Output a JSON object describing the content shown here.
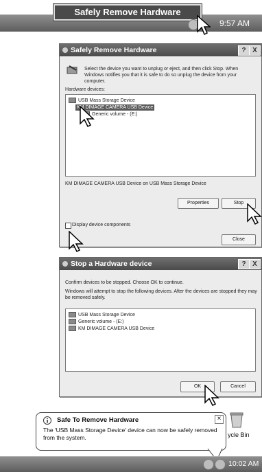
{
  "top_taskbar": {
    "tooltip": "Safely Remove Hardware",
    "time": "9:57 AM"
  },
  "safely_remove_window": {
    "title": "Safely Remove Hardware",
    "instructions": "Select the device you want to unplug or eject, and then click Stop. When Windows notifies you that it is safe to do so unplug the device from your computer.",
    "hardware_label": "Hardware devices:",
    "devices": [
      "USB Mass Storage Device",
      "KM DIMAGE CAMERA USB Device",
      "Generic volume - (E:)"
    ],
    "status": "KM DIMAGE CAMERA USB Device on USB Mass Storage Device",
    "properties_btn": "Properties",
    "stop_btn": "Stop",
    "display_components": "Display device components",
    "close_btn": "Close"
  },
  "stop_window": {
    "title": "Stop a Hardware device",
    "confirm": "Confirm devices to be stopped. Choose OK to continue.",
    "info": "Windows will attempt to stop the following devices. After the devices are stopped they may be removed safely.",
    "devices": [
      "USB Mass Storage Device",
      "Generic volume - (E:)",
      "KM DIMAGE CAMERA USB Device"
    ],
    "ok_btn": "OK",
    "cancel_btn": "Cancel"
  },
  "balloon": {
    "title": "Safe To Remove Hardware",
    "message": "The 'USB Mass Storage Device' device can now be safely removed from the system.",
    "close": "×"
  },
  "desktop": {
    "recycle_label": "ycle Bin"
  },
  "bottom_taskbar": {
    "time": "10:02 AM"
  }
}
